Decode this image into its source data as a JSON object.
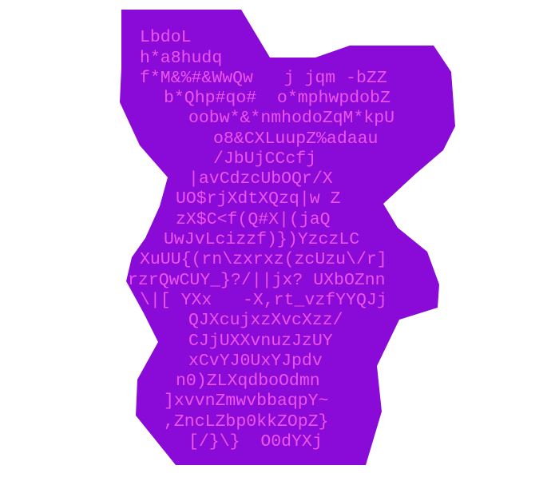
{
  "colors": {
    "background": "#ffffff",
    "shape_fill": "#8a0ad8",
    "text": "#ee55ee"
  },
  "art": {
    "lines": [
      {
        "text": "LbdoL"
      },
      {
        "text": "h*a8hudq"
      },
      {
        "text": "f*M&%#&WwQw   j jqm -bZZ"
      },
      {
        "text": "b*Qhp#qo#  o*mphwpdobZ"
      },
      {
        "text": "oobw*&*nmhodoZqM*kpU"
      },
      {
        "text": "o8&CXLuupZ%adaau"
      },
      {
        "text": "/JbUjCCcfj"
      },
      {
        "text": "|avCdzcUbOQr/X"
      },
      {
        "text": "UO$rjXdtXQzq|w Z"
      },
      {
        "text": "zX$C<f(Q#X|(jaQ"
      },
      {
        "text": "UwJvLcizzf)})YzczLC"
      },
      {
        "text": "XuUU{(rn\\zxrxz(zcUzu\\/r]"
      },
      {
        "text": "rzrQwCUY_}?/||jx? UXbOZnn"
      },
      {
        "text": "\\|[ YXx   -X,rt_vzfYYQJj"
      },
      {
        "text": "QJXcujxzXvcXzz/"
      },
      {
        "text": "CJjUXXvnuzJzUY"
      },
      {
        "text": "xCvYJ0UxYJpdv"
      },
      {
        "text": "n0)ZLXqdboOdmn"
      },
      {
        "text": "]xvvnZmwvbbaqpY~"
      },
      {
        "text": ",ZncLZbp0kkZOpZ}"
      },
      {
        "text": "[/}\\}  O0dYXj"
      }
    ]
  }
}
